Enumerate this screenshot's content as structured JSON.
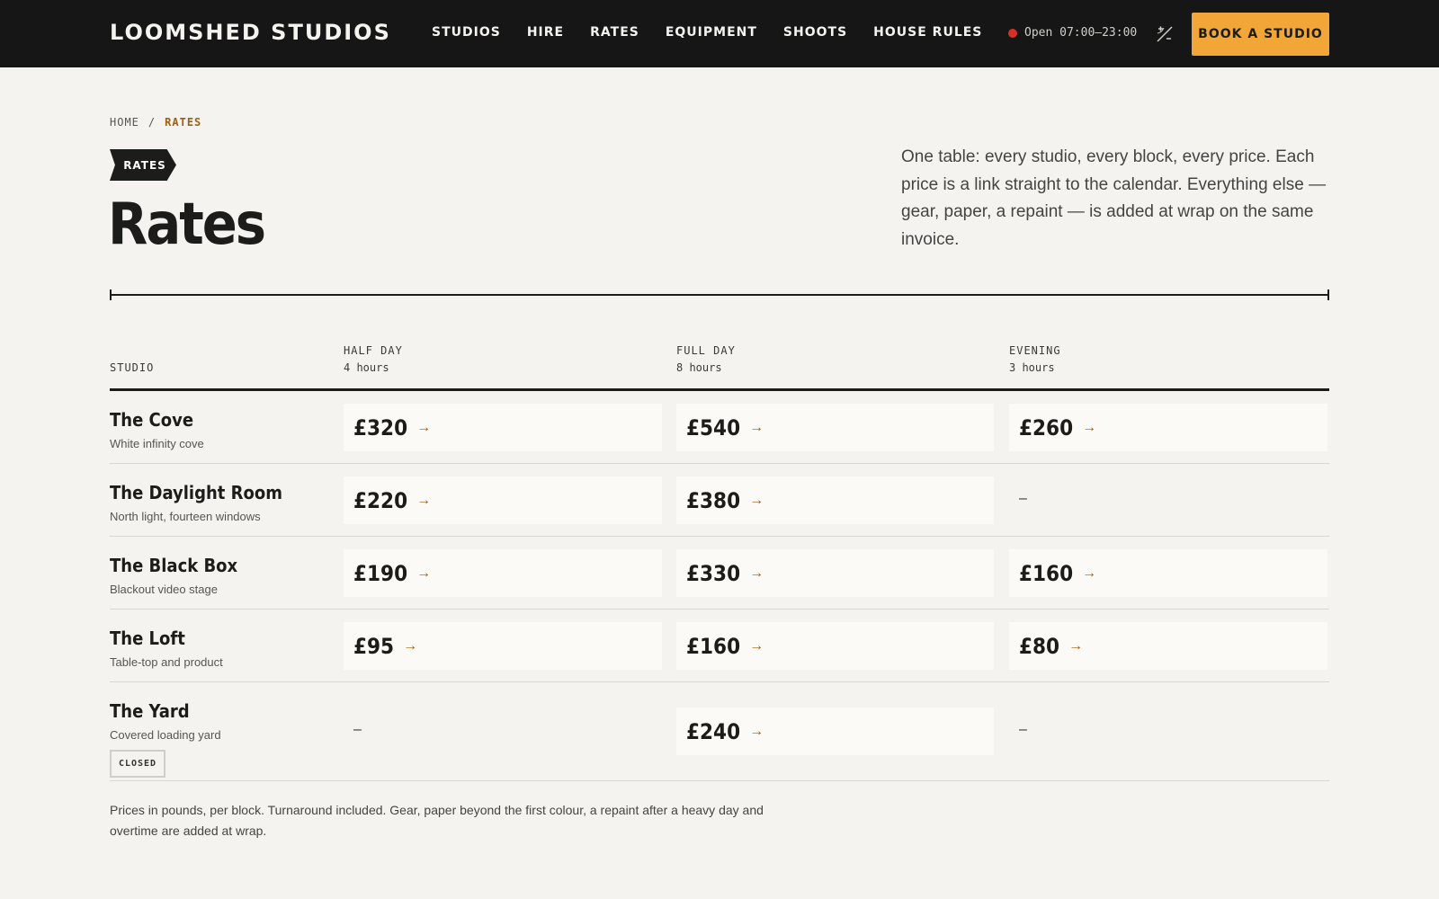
{
  "header": {
    "brand": "LOOMSHED STUDIOS",
    "nav": [
      "STUDIOS",
      "HIRE",
      "RATES",
      "EQUIPMENT",
      "SHOOTS",
      "HOUSE RULES"
    ],
    "status": "Open 07:00–23:00",
    "status_color": "#d93025",
    "theme_icon": "contrast-toggle-icon",
    "book_label": "BOOK A STUDIO",
    "accent_color": "#f1a637"
  },
  "breadcrumb": {
    "home": "HOME",
    "separator": "/",
    "current": "RATES"
  },
  "hero": {
    "tag": "RATES",
    "title": "Rates",
    "intro": "One table: every studio, every block, every price. Each price is a link straight to the calendar. Everything else — gear, paper, a repaint — is added at wrap on the same invoice."
  },
  "table": {
    "columns": [
      {
        "label": "STUDIO",
        "sub": ""
      },
      {
        "label": "HALF DAY",
        "sub": "4 hours"
      },
      {
        "label": "FULL DAY",
        "sub": "8 hours"
      },
      {
        "label": "EVENING",
        "sub": "3 hours"
      }
    ],
    "rows": [
      {
        "name": "The Cove",
        "desc": "White infinity cove",
        "badge": "",
        "prices": [
          "£320",
          "£540",
          "£260"
        ]
      },
      {
        "name": "The Daylight Room",
        "desc": "North light, fourteen windows",
        "badge": "",
        "prices": [
          "£220",
          "£380",
          "–"
        ]
      },
      {
        "name": "The Black Box",
        "desc": "Blackout video stage",
        "badge": "",
        "prices": [
          "£190",
          "£330",
          "£160"
        ]
      },
      {
        "name": "The Loft",
        "desc": "Table-top and product",
        "badge": "",
        "prices": [
          "£95",
          "£160",
          "£80"
        ]
      },
      {
        "name": "The Yard",
        "desc": "Covered loading yard",
        "badge": "CLOSED",
        "prices": [
          "–",
          "£240",
          "–"
        ]
      }
    ],
    "arrow": "→"
  },
  "footnote": "Prices in pounds, per block. Turnaround included. Gear, paper beyond the first colour, a repaint after a heavy day and overtime are added at wrap."
}
